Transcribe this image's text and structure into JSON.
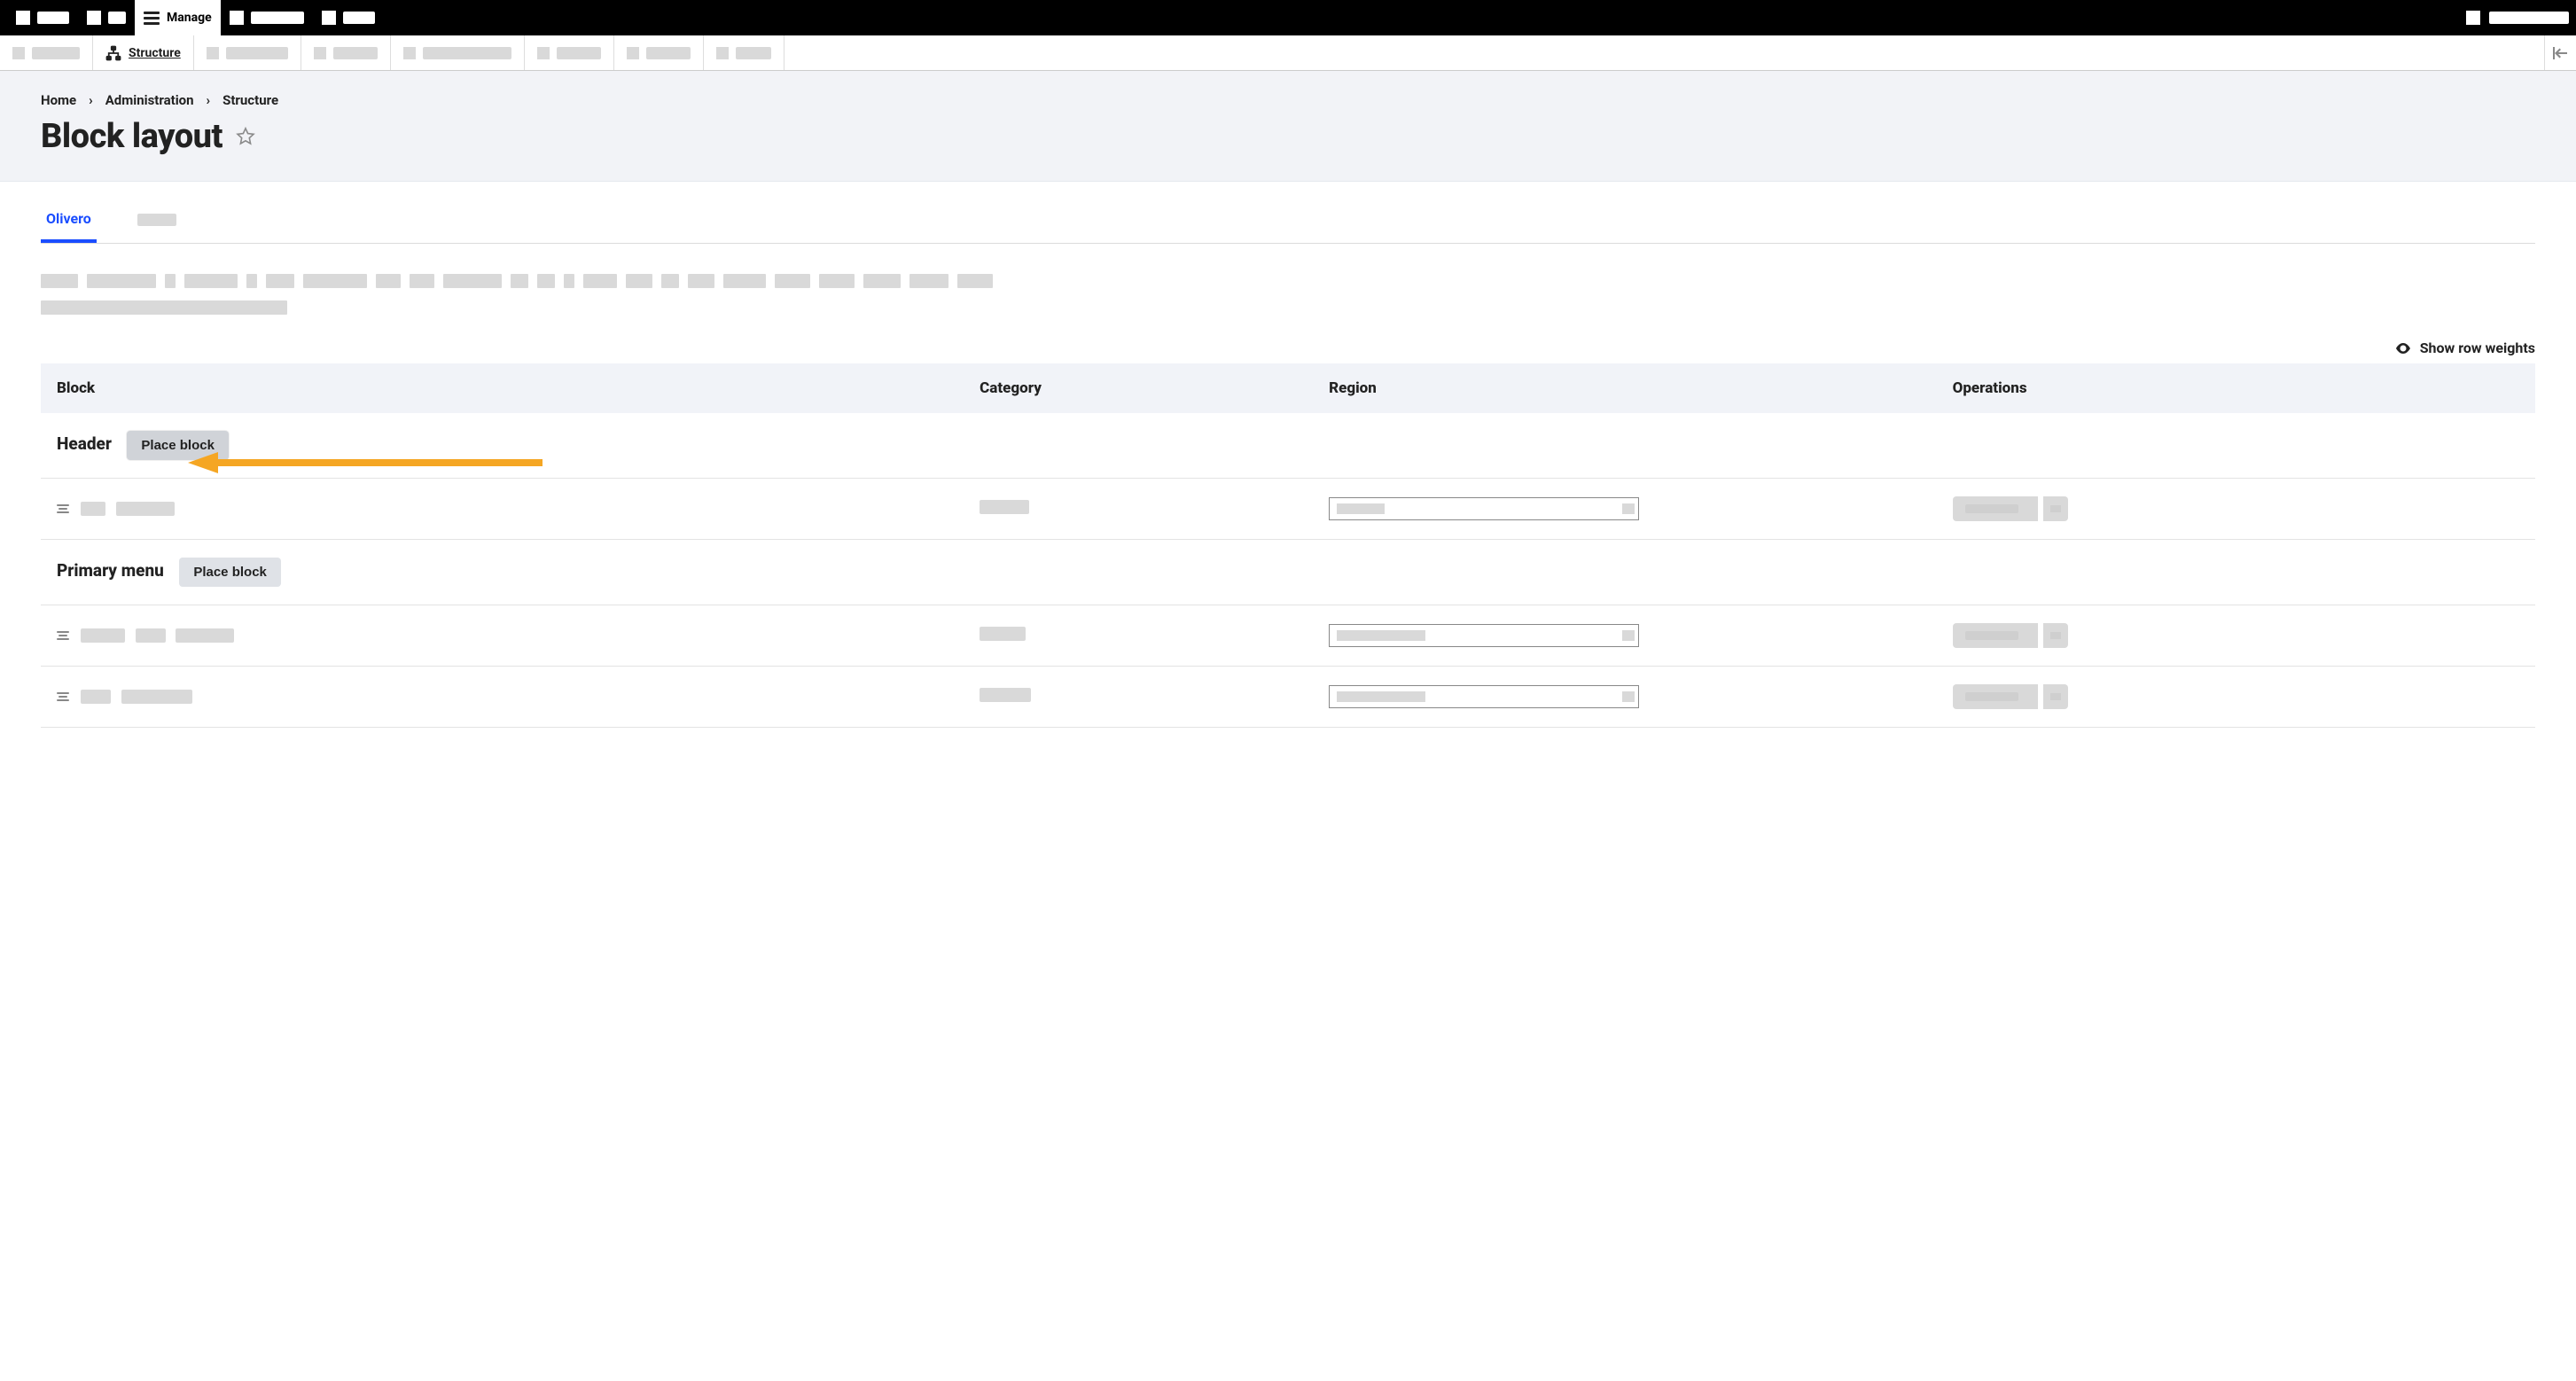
{
  "toolbar": {
    "manage_label": "Manage"
  },
  "secondary": {
    "structure_label": "Structure"
  },
  "breadcrumb": {
    "home": "Home",
    "admin": "Administration",
    "structure": "Structure"
  },
  "page_title": "Block layout",
  "tabs": {
    "active": "Olivero"
  },
  "row_weights_label": "Show row weights",
  "table": {
    "col_block": "Block",
    "col_category": "Category",
    "col_region": "Region",
    "col_operations": "Operations"
  },
  "regions": {
    "header": {
      "label": "Header",
      "place": "Place block"
    },
    "primary_menu": {
      "label": "Primary menu",
      "place": "Place block"
    }
  }
}
